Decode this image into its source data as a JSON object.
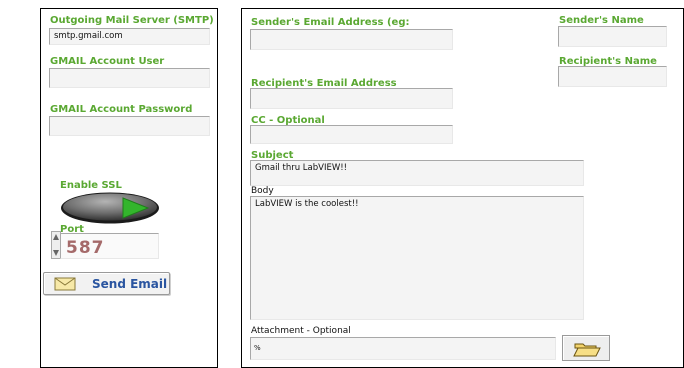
{
  "left_panel": {
    "smtp_label": "Outgoing Mail Server (SMTP)",
    "smtp_value": "smtp.gmail.com",
    "user_label": "GMAIL Account User",
    "user_value": "",
    "password_label": "GMAIL Account Password",
    "password_value": "",
    "ssl_label": "Enable SSL",
    "ssl_enabled": true,
    "port_label": "Port",
    "port_value": "587",
    "send_label": "Send Email"
  },
  "right_panel": {
    "sender_email_label": "Sender's Email Address (eg:",
    "sender_email_value": "",
    "sender_name_label": "Sender's Name",
    "sender_name_value": "",
    "recipient_email_label": "Recipient's Email Address",
    "recipient_email_value": "",
    "recipient_name_label": "Recipient's Name",
    "recipient_name_value": "",
    "cc_label": "CC - Optional",
    "cc_value": "",
    "subject_label": "Subject",
    "subject_value": "Gmail thru LabVIEW!!",
    "body_label": "Body",
    "body_value": "LabVIEW is the coolest!!",
    "attachment_label": "Attachment - Optional",
    "attachment_value": "",
    "path_prefix": "%"
  },
  "colors": {
    "label_green": "#5aa832",
    "button_text_blue": "#2a55a0",
    "port_text": "#a56a6a",
    "toggle_led_green": "#33b52c"
  },
  "icons": {
    "send_button_icon": "envelope-icon",
    "browse_button_icon": "folder-icon"
  }
}
